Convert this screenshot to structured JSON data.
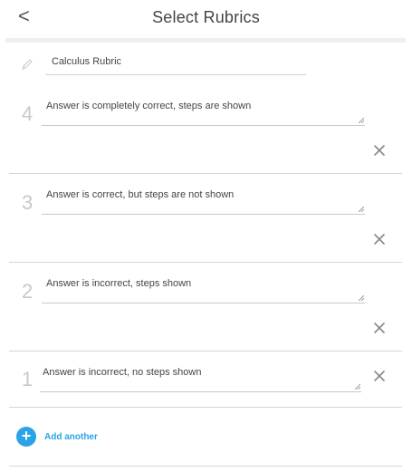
{
  "header": {
    "back_glyph": "<",
    "title": "Select Rubrics"
  },
  "rubric_name": {
    "icon": "pencil-icon",
    "value": "Calculus Rubric"
  },
  "rubrics": [
    {
      "score": "4",
      "description": "Answer is completely correct, steps are shown",
      "has_remove": true
    },
    {
      "score": "3",
      "description": "Answer is correct, but steps are not shown",
      "has_remove": true
    },
    {
      "score": "2",
      "description": "Answer is incorrect, steps shown",
      "has_remove": true
    },
    {
      "score": "1",
      "description": "Answer is incorrect, no steps shown",
      "has_remove": true
    }
  ],
  "add": {
    "icon_glyph": "+",
    "label": "Add another"
  },
  "colors": {
    "accent": "#2aa4e6",
    "score_gray": "#c8c8c8",
    "divider": "#d6d6d6"
  }
}
